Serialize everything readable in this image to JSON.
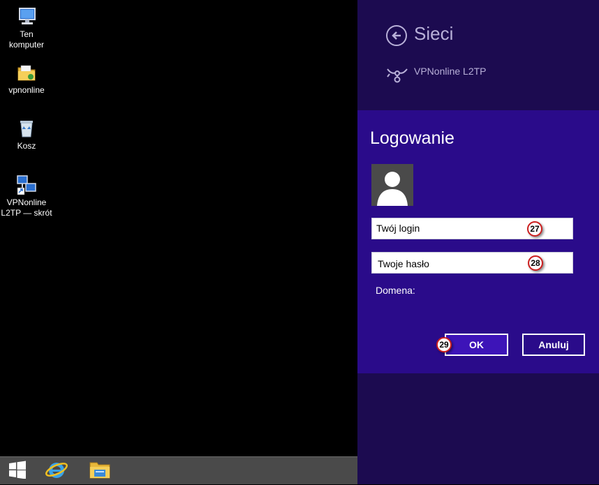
{
  "desktop": {
    "icons": [
      {
        "icon": "computer-icon",
        "label": "Ten\nkomputer"
      },
      {
        "icon": "folder-icon",
        "label": "vpnonline"
      },
      {
        "icon": "recycle-bin-icon",
        "label": "Kosz"
      },
      {
        "icon": "network-shortcut-icon",
        "label": "VPNonline\nL2TP — skrót"
      }
    ]
  },
  "taskbar": {
    "items": [
      "windows-start-icon",
      "internet-explorer-icon",
      "file-explorer-icon"
    ]
  },
  "charm": {
    "title": "Sieci",
    "network_name": "VPNonline L2TP",
    "login": {
      "title": "Logowanie",
      "login_value": "Twój login",
      "password_value": "Twoje hasło",
      "domain_label": "Domena:",
      "ok_label": "OK",
      "cancel_label": "Anuluj"
    },
    "callouts": [
      "27",
      "28",
      "29"
    ]
  },
  "colors": {
    "charm_bg": "#1c0b50",
    "login_bg": "#2a0b8a",
    "ok_bg": "#3d14b8",
    "taskbar_bg": "#4a4a4a",
    "callout_border": "#cc2020"
  }
}
